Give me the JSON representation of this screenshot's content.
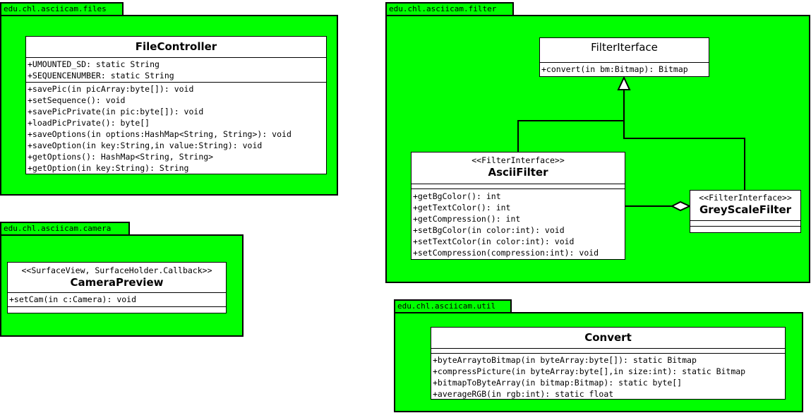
{
  "packages": {
    "files": "edu.chl.asciicam.files",
    "filter": "edu.chl.asciicam.filter",
    "camera": "edu.chl.asciicam.camera",
    "util": "edu.chl.asciicam.util"
  },
  "classes": {
    "file_controller": {
      "name": "FileController",
      "attributes": [
        "+UMOUNTED_SD: static String",
        "+SEQUENCENUMBER: static String"
      ],
      "methods": [
        "+savePic(in picArray:byte[]): void",
        "+setSequence(): void",
        "+savePicPrivate(in pic:byte[]): void",
        "+loadPicPrivate(): byte[]",
        "+saveOptions(in options:HashMap<String, String>): void",
        "+saveOption(in key:String,in value:String): void",
        "+getOptions(): HashMap<String, String>",
        "+getOption(in key:String): String"
      ]
    },
    "filter_interface": {
      "name": "FilterIterface",
      "methods": [
        "+convert(in bm:Bitmap): Bitmap"
      ]
    },
    "ascii_filter": {
      "stereotype": "<<FilterInterface>>",
      "name": "AsciiFilter",
      "methods": [
        "+getBgColor(): int",
        "+getTextColor(): int",
        "+getCompression(): int",
        "+setBgColor(in color:int): void",
        "+setTextColor(in color:int): void",
        "+setCompression(compression:int): void"
      ]
    },
    "greyscale_filter": {
      "stereotype": "<<FilterInterface>>",
      "name": "GreyScaleFilter"
    },
    "camera_preview": {
      "stereotype": "<<SurfaceView, SurfaceHolder.Callback>>",
      "name": "CameraPreview",
      "methods": [
        "+setCam(in c:Camera): void"
      ]
    },
    "convert": {
      "name": "Convert",
      "methods": [
        "+byteArraytoBitmap(in byteArray:byte[]): static Bitmap",
        "+compressPicture(in byteArray:byte[],in size:int): static Bitmap",
        "+bitmapToByteArray(in bitmap:Bitmap): static byte[]",
        "+averageRGB(in rgb:int): static float"
      ]
    }
  },
  "colors": {
    "package_fill": "#00ff00",
    "class_fill": "#ffffff",
    "line": "#000000"
  }
}
